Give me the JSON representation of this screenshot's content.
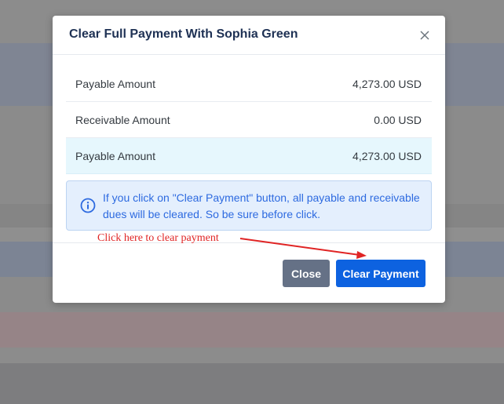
{
  "modal": {
    "title": "Clear Full Payment With Sophia Green",
    "close_icon": "close-icon",
    "rows": [
      {
        "label": "Payable Amount",
        "value": "4,273.00 USD"
      },
      {
        "label": "Receivable Amount",
        "value": "0.00 USD"
      },
      {
        "label": "Payable Amount",
        "value": "4,273.00 USD"
      }
    ],
    "alert": {
      "icon": "info-icon",
      "text": "If you click on \"Clear Payment\" button, all payable and receivable dues will be cleared. So be sure before click."
    },
    "buttons": {
      "close_label": "Close",
      "clear_label": "Clear Payment"
    }
  },
  "annotation": {
    "text": "Click here to clear payment"
  },
  "colors": {
    "primary": "#0d62e0",
    "secondary": "#657186",
    "highlight_row": "#e6f7fd",
    "alert_bg": "#e4effd",
    "alert_text": "#2d6ae0",
    "annotation": "#e02424"
  }
}
